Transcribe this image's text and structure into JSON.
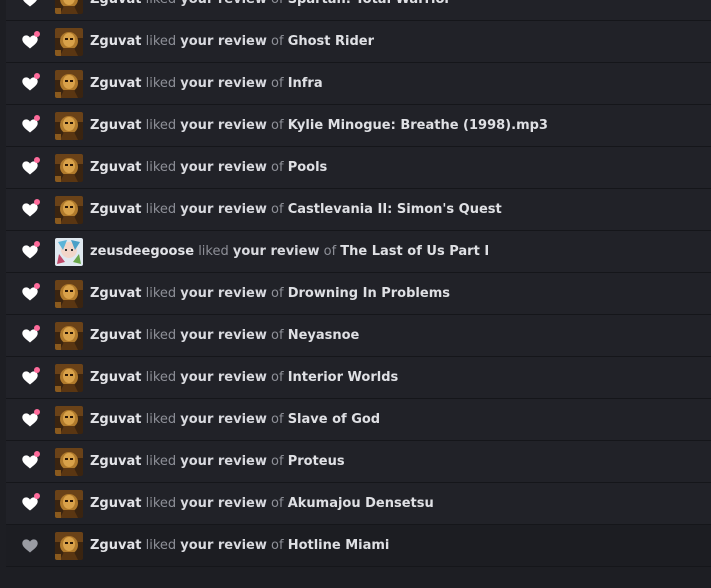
{
  "words": {
    "liked": "liked",
    "your_review": "your review",
    "of": "of"
  },
  "notifications": [
    {
      "user": "Zguvat",
      "game": "Spartan: Total Warrior",
      "avatar": "zguvat-avatar",
      "unread": true
    },
    {
      "user": "Zguvat",
      "game": "Ghost Rider",
      "avatar": "zguvat-avatar",
      "unread": true
    },
    {
      "user": "Zguvat",
      "game": "Infra",
      "avatar": "zguvat-avatar",
      "unread": true
    },
    {
      "user": "Zguvat",
      "game": "Kylie Minogue: Breathe (1998).mp3",
      "avatar": "zguvat-avatar",
      "unread": true
    },
    {
      "user": "Zguvat",
      "game": "Pools",
      "avatar": "zguvat-avatar",
      "unread": true
    },
    {
      "user": "Zguvat",
      "game": "Castlevania II: Simon's Quest",
      "avatar": "zguvat-avatar",
      "unread": true
    },
    {
      "user": "zeusdeegoose",
      "game": "The Last of Us Part I",
      "avatar": "zeusdeegoose-avatar",
      "unread": true
    },
    {
      "user": "Zguvat",
      "game": "Drowning In Problems",
      "avatar": "zguvat-avatar",
      "unread": true
    },
    {
      "user": "Zguvat",
      "game": "Neyasnoe",
      "avatar": "zguvat-avatar",
      "unread": true
    },
    {
      "user": "Zguvat",
      "game": "Interior Worlds",
      "avatar": "zguvat-avatar",
      "unread": true
    },
    {
      "user": "Zguvat",
      "game": "Slave of God",
      "avatar": "zguvat-avatar",
      "unread": true
    },
    {
      "user": "Zguvat",
      "game": "Proteus",
      "avatar": "zguvat-avatar",
      "unread": true
    },
    {
      "user": "Zguvat",
      "game": "Akumajou Densetsu",
      "avatar": "zguvat-avatar",
      "unread": true
    },
    {
      "user": "Zguvat",
      "game": "Hotline Miami",
      "avatar": "zguvat-avatar",
      "unread": false
    }
  ],
  "colors": {
    "heart_unread": "#ffffff",
    "heart_read": "#9a9ca3",
    "unread_dot": "#ff6b9b"
  }
}
